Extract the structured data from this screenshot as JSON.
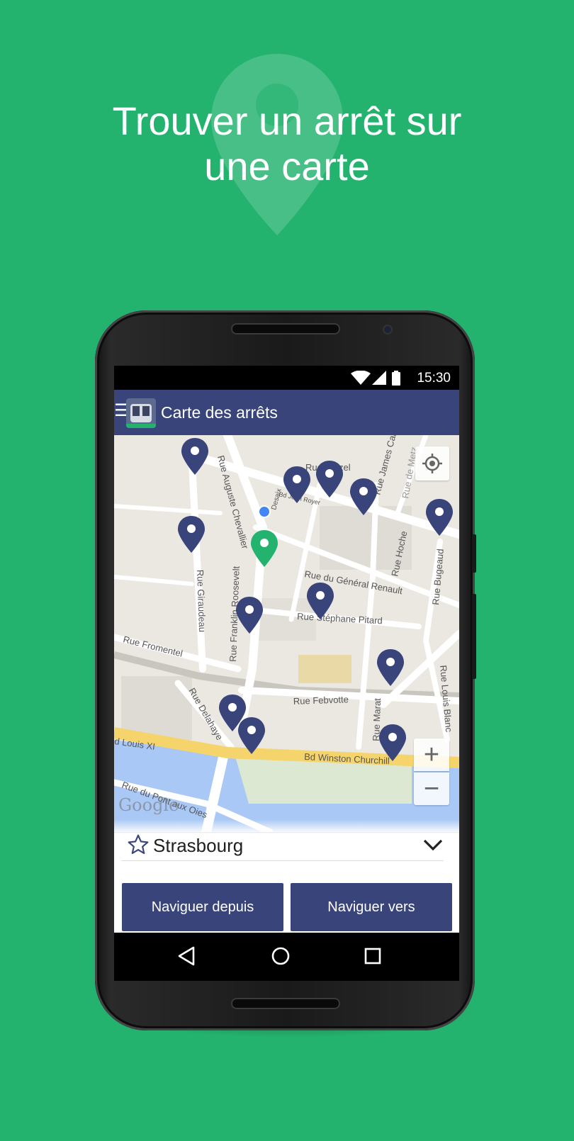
{
  "headline": {
    "line1": "Trouver un arrêt sur",
    "line2": "une carte"
  },
  "statusbar": {
    "time": "15:30"
  },
  "appbar": {
    "title": "Carte des arrêts",
    "menu_icon": "menu-icon"
  },
  "map": {
    "streets": [
      "Rue Cluzel",
      "Bd Jean Royer",
      "Rue James Cane",
      "Rue de Metz",
      "Rue Auguste Chevallier",
      "Desaix",
      "Rue Giraudeau",
      "Rue Franklin Roosevelt",
      "Rue du Général Renault",
      "Rue Stéphane Pitard",
      "Rue Hoche",
      "Rue Bugeaud",
      "Rue Fromentel",
      "Rue Febvotte",
      "Rue Delahaye",
      "Rue Marat",
      "Rue Louis Blanc",
      "d Louis XI",
      "Bd Winston Churchill",
      "Rue du Pont aux Oies"
    ],
    "zoom_in": "+",
    "zoom_out": "−",
    "attribution": "Google",
    "marker_color_default": "#38447a",
    "marker_color_selected": "#24b36f"
  },
  "stop": {
    "name": "Strasbourg"
  },
  "buttons": {
    "from": "Naviguer depuis",
    "to": "Naviguer vers"
  },
  "colors": {
    "background": "#24b36f",
    "primary": "#38447a"
  }
}
